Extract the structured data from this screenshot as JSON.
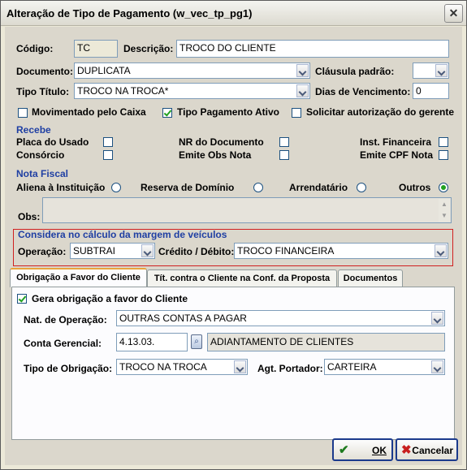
{
  "window": {
    "title": "Alteração de Tipo de Pagamento (w_vec_tp_pg1)"
  },
  "form": {
    "codigo_label": "Código:",
    "codigo_value": "TC",
    "descricao_label": "Descrição:",
    "descricao_value": "TROCO DO CLIENTE",
    "documento_label": "Documento:",
    "documento_value": "DUPLICATA",
    "clausula_label": "Cláusula padrão:",
    "clausula_value": "",
    "tipo_titulo_label": "Tipo Título:",
    "tipo_titulo_value": "TROCO NA TROCA*",
    "dias_label": "Dias de Vencimento:",
    "dias_value": "0",
    "movimentado_label": "Movimentado pelo Caixa",
    "movimentado_checked": false,
    "ativo_label": "Tipo Pagamento Ativo",
    "ativo_checked": true,
    "solicitar_label": "Solicitar autorização do gerente",
    "solicitar_checked": false
  },
  "recebe": {
    "title": "Recebe",
    "placa": "Placa do Usado",
    "consorcio": "Consórcio",
    "nr_doc": "NR do Documento",
    "emite_obs": "Emite Obs Nota",
    "inst_fin": "Inst. Financeira",
    "emite_cpf": "Emite CPF Nota"
  },
  "nota": {
    "title": "Nota Fiscal",
    "aliena": "Aliena à Instituição",
    "reserva": "Reserva de Domínio",
    "arrendatario": "Arrendatário",
    "outros": "Outros",
    "selected": "Outros",
    "obs_label": "Obs:",
    "obs_value": ""
  },
  "margem": {
    "title": "Considera no cálculo da margem de veículos",
    "operacao_label": "Operação:",
    "operacao_value": "SUBTRAI",
    "credito_label": "Crédito / Débito:",
    "credito_value": "TROCO FINANCEIRA"
  },
  "tabs": [
    {
      "label": "Obrigação a Favor do Cliente"
    },
    {
      "label": "Tít. contra o Cliente na Conf. da Proposta"
    },
    {
      "label": "Documentos"
    }
  ],
  "tab_panel": {
    "gera_label": "Gera obrigação a favor do Cliente",
    "gera_checked": true,
    "nat_label": "Nat. de Operação:",
    "nat_value": "OUTRAS CONTAS A PAGAR",
    "conta_label": "Conta Gerencial:",
    "conta_value": "4.13.03.",
    "conta_desc": "ADIANTAMENTO DE CLIENTES",
    "tipo_obr_label": "Tipo de Obrigação:",
    "tipo_obr_value": "TROCO NA TROCA",
    "agt_label": "Agt. Portador:",
    "agt_value": "CARTEIRA"
  },
  "buttons": {
    "ok": "OK",
    "cancelar": "Cancelar"
  }
}
